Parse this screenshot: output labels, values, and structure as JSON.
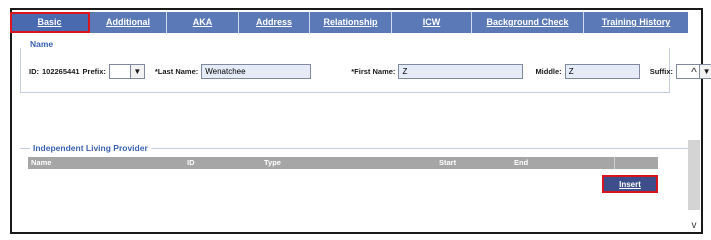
{
  "tabs": [
    {
      "label": "Basic",
      "active": true
    },
    {
      "label": "Additional",
      "active": false
    },
    {
      "label": "AKA",
      "active": false
    },
    {
      "label": "Address",
      "active": false
    },
    {
      "label": "Relationship",
      "active": false
    },
    {
      "label": "ICW",
      "active": false
    },
    {
      "label": "Background Check",
      "active": false
    },
    {
      "label": "Training History",
      "active": false
    }
  ],
  "name_section": {
    "legend": "Name",
    "id_label": "ID:",
    "id_value": "102265441",
    "prefix_label": "Prefix:",
    "prefix_value": "",
    "last_name_label": "*Last Name:",
    "last_name_value": "Wenatchee",
    "first_name_label": "*First Name:",
    "first_name_value": "Z",
    "middle_label": "Middle:",
    "middle_value": "Z",
    "suffix_label": "Suffix:",
    "suffix_value": ""
  },
  "ilp_section": {
    "legend": "Independent Living Provider",
    "columns": [
      "Name",
      "ID",
      "Type",
      "Start",
      "End",
      ""
    ],
    "insert_label": "Insert"
  },
  "icons": {
    "dropdown": "▼",
    "scroll_up": "^",
    "scroll_down": "v"
  },
  "colors": {
    "tab_bar": "#5b79b6",
    "highlight": "#d8141e",
    "legend_text": "#3b62b0",
    "table_header": "#a6a6a6",
    "insert_button": "#3d4e8a"
  }
}
